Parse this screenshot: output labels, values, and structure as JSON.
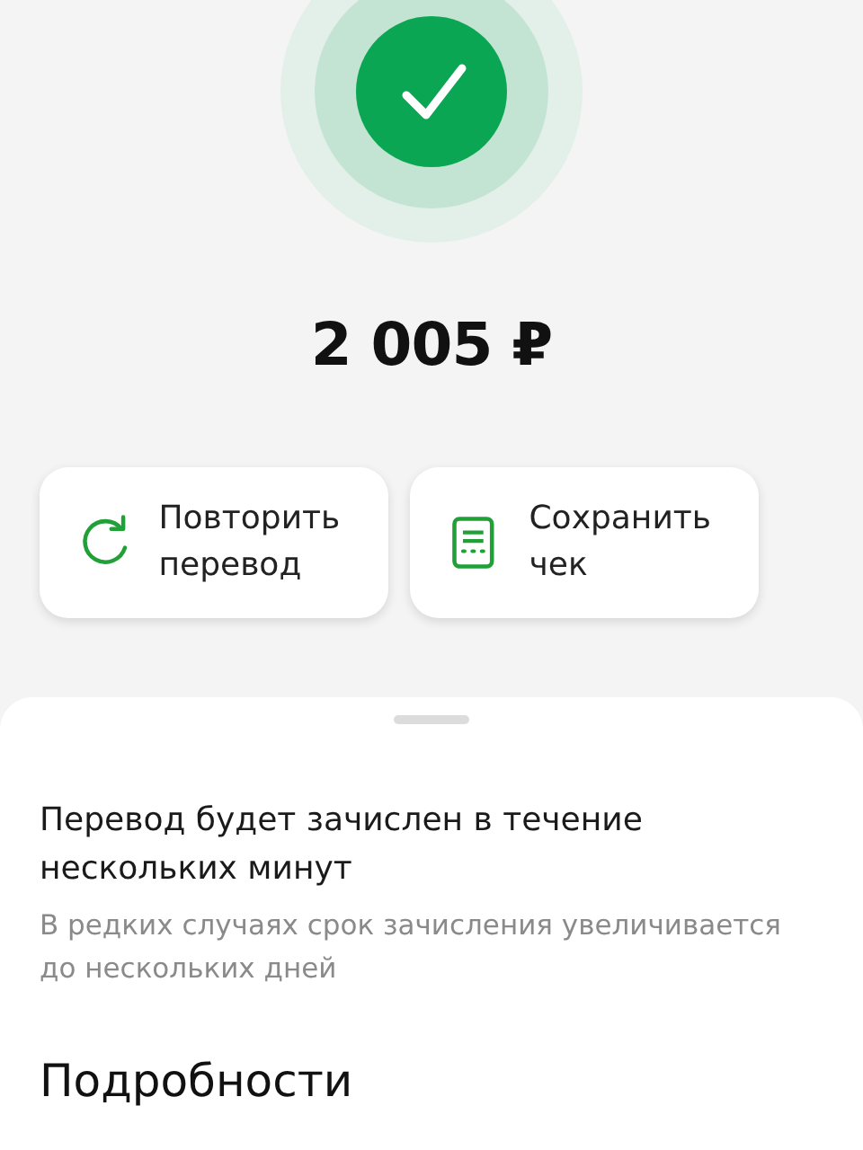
{
  "amount": "2 005 ₽",
  "actions": [
    {
      "kind": "repeat",
      "label": "Повторить перевод"
    },
    {
      "kind": "receipt",
      "label": "Сохранить чек"
    }
  ],
  "sheet": {
    "title": "Перевод будет зачислен в течение нескольких минут",
    "note": "В редких случаях срок зачисления увеличивается до нескольких дней",
    "section_title": "Подробности"
  }
}
